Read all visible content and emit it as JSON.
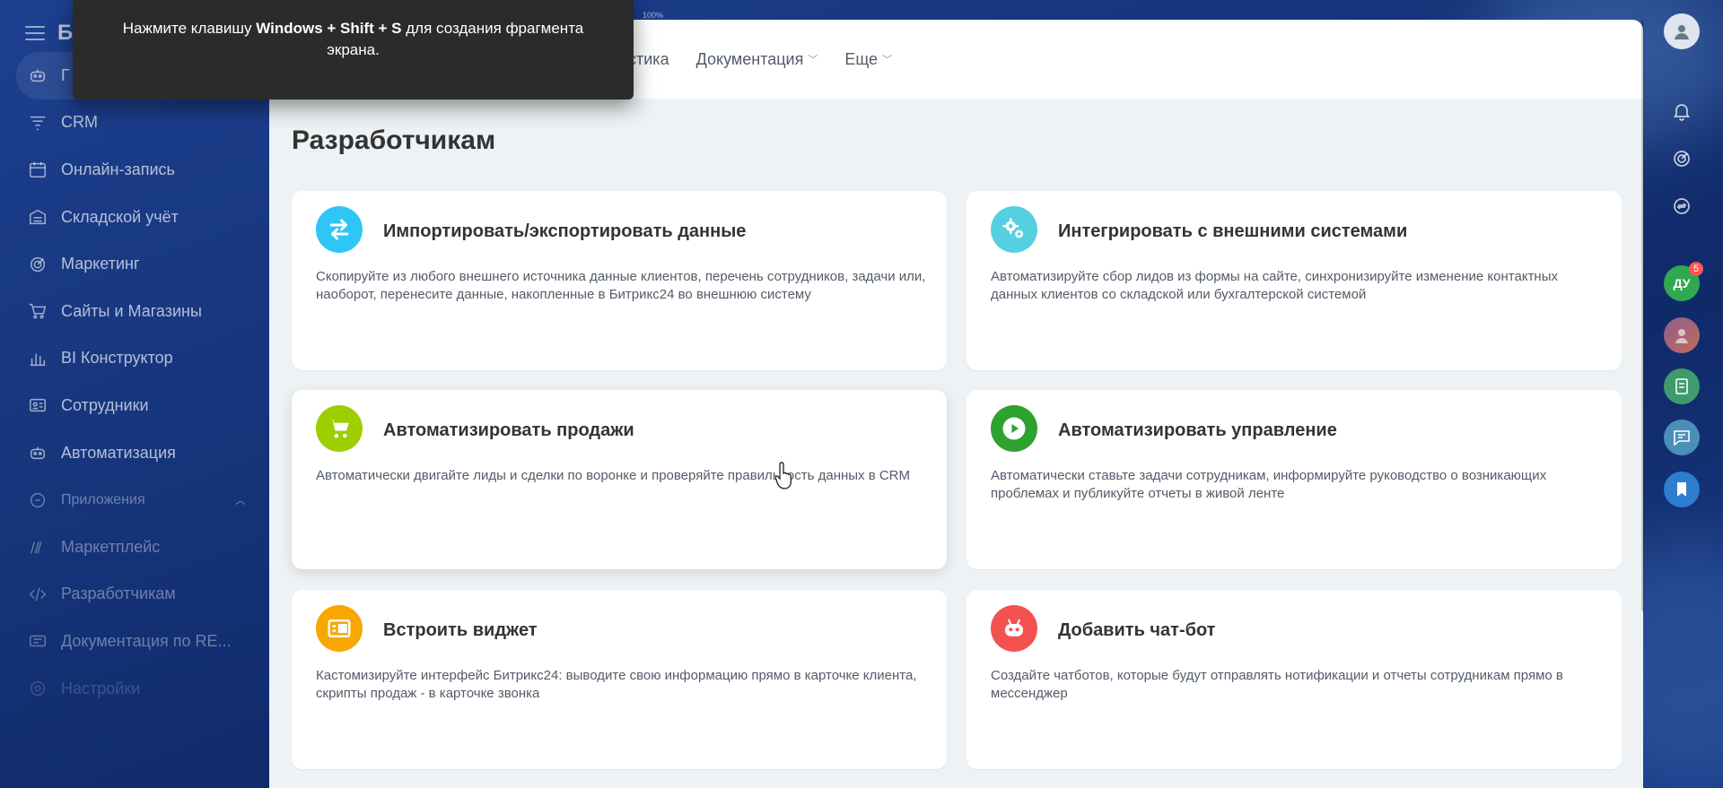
{
  "toast": {
    "prefix": "Нажмите клавишу ",
    "keys": "Windows + Shift + S",
    "suffix": " для создания фрагмента экрана."
  },
  "scale_label": "100%",
  "sidebar": {
    "brand": "Б",
    "items": [
      {
        "label": "Г",
        "icon": "robot-icon"
      },
      {
        "label": "CRM",
        "icon": "funnel-icon"
      },
      {
        "label": "Онлайн-запись",
        "icon": "calendar-icon"
      },
      {
        "label": "Складской учёт",
        "icon": "warehouse-icon"
      },
      {
        "label": "Маркетинг",
        "icon": "target-icon"
      },
      {
        "label": "Сайты и Магазины",
        "icon": "cart-icon"
      },
      {
        "label": "BI Конструктор",
        "icon": "chart-icon"
      },
      {
        "label": "Сотрудники",
        "icon": "id-card-icon"
      },
      {
        "label": "Автоматизация",
        "icon": "robot-icon"
      }
    ],
    "apps_section": "Приложения",
    "app_items": [
      {
        "label": "Маркетплейс",
        "icon": "marketplace-icon"
      },
      {
        "label": "Разработчикам",
        "icon": "code-icon"
      },
      {
        "label": "Документация по RE...",
        "icon": "docs-icon"
      }
    ],
    "settings": "Настройки"
  },
  "topbar": {
    "nav": [
      {
        "label": "стика",
        "has_dropdown": false
      },
      {
        "label": "Документация",
        "has_dropdown": true
      },
      {
        "label": "Еще",
        "has_dropdown": true
      }
    ]
  },
  "page": {
    "title": "Разработчикам",
    "cards": [
      {
        "title": "Импортировать/экспортировать данные",
        "desc": "Скопируйте из любого внешнего источника данные клиентов, перечень сотрудников, задачи или, наоборот, перенесите данные, накопленные в Битрикс24 во внешнюю систему",
        "icon": "swap-arrows-icon",
        "color": "#2fc6f6"
      },
      {
        "title": "Интегрировать с внешними системами",
        "desc": "Автоматизируйте сбор лидов из формы на сайте, синхронизируйте изменение контактных данных клиентов со складской или бухгалтерской системой",
        "icon": "gears-icon",
        "color": "#55d0e0"
      },
      {
        "title": "Автоматизировать продажи",
        "desc": "Автоматически двигайте лиды и сделки по воронке и проверяйте правильность данных в CRM",
        "icon": "cart-icon",
        "color": "#9dcf00"
      },
      {
        "title": "Автоматизировать управление",
        "desc": "Автоматически ставьте задачи сотрудникам, информируйте руководство о возникающих проблемах и публикуйте отчеты в живой ленте",
        "icon": "play-icon",
        "color": "#2ea22f"
      },
      {
        "title": "Встроить виджет",
        "desc": "Кастомизируйте интерфейс Битрикс24: выводите свою информацию прямо в карточке клиента, скрипты продаж - в карточке звонка",
        "icon": "widget-icon",
        "color": "#f7a700"
      },
      {
        "title": "Добавить чат-бот",
        "desc": "Создайте чатботов, которые будут отправлять нотификации и отчеты сотрудникам прямо в мессенджер",
        "icon": "bot-icon",
        "color": "#f4524f"
      }
    ]
  },
  "rightbar": {
    "avatar_initials": "ДУ",
    "avatar_badge": "5"
  }
}
